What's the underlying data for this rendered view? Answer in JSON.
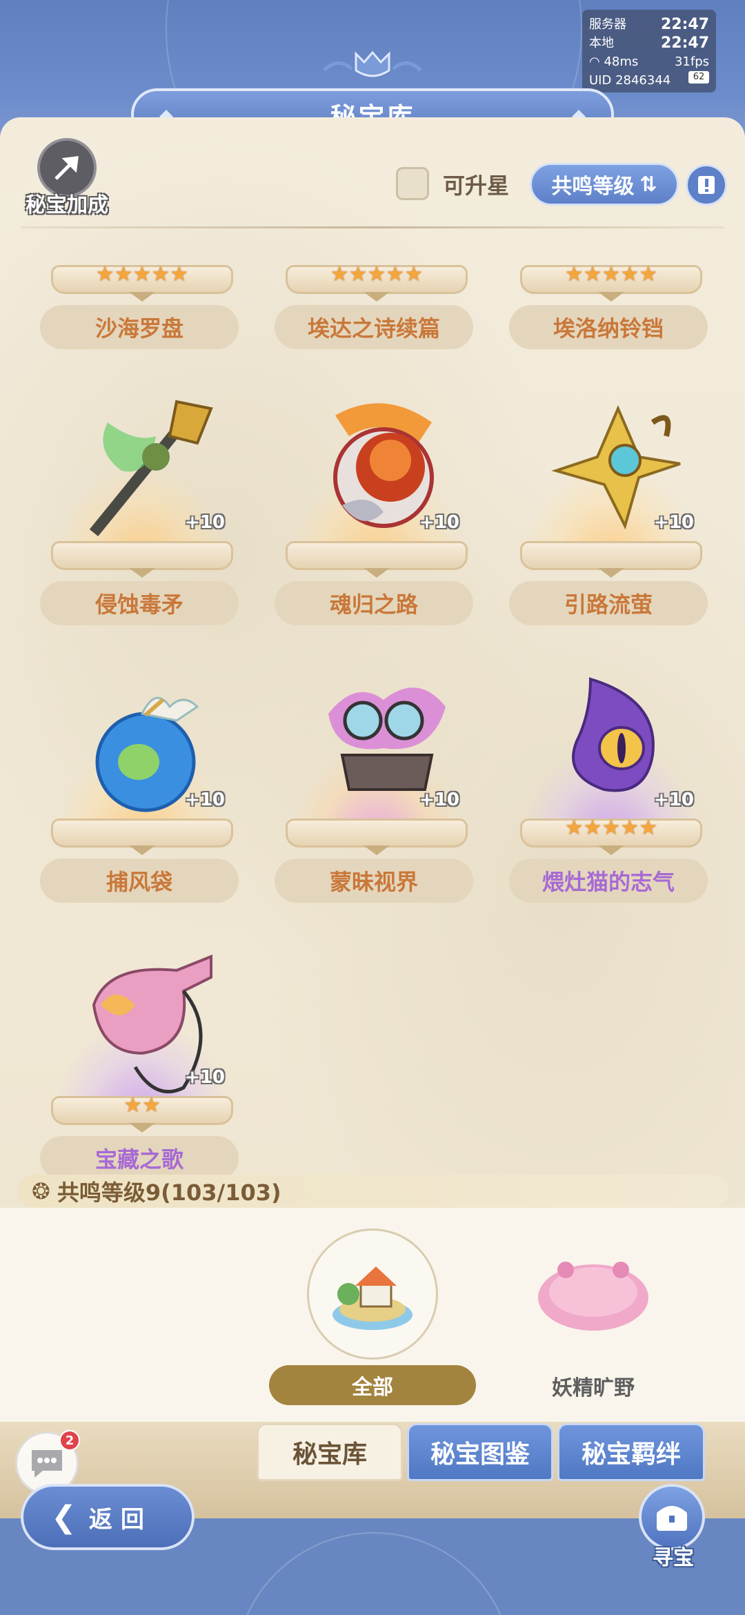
{
  "status": {
    "server_label": "服务器",
    "server_time": "22:47",
    "local_label": "本地",
    "local_time": "22:47",
    "ping": "48ms",
    "fps": "31fps",
    "uid": "UID 2846344",
    "battery": "62"
  },
  "header": {
    "title": "秘宝库",
    "bonus_label": "秘宝加成"
  },
  "filters": {
    "upgradeable_label": "可升星",
    "upgradeable_checked": false,
    "sort_label": "共鸣等级"
  },
  "treasures": [
    {
      "name": "沙海罗盘",
      "stars": "★★★★★",
      "plus": "",
      "rarity": "gold"
    },
    {
      "name": "埃达之诗续篇",
      "stars": "★★★★★",
      "plus": "",
      "rarity": "gold"
    },
    {
      "name": "埃洛纳铃铛",
      "stars": "★★★★★",
      "plus": "",
      "rarity": "gold"
    },
    {
      "name": "侵蚀毒矛",
      "stars": "",
      "plus": "+10",
      "rarity": "gold"
    },
    {
      "name": "魂归之路",
      "stars": "",
      "plus": "+10",
      "rarity": "gold"
    },
    {
      "name": "引路流萤",
      "stars": "",
      "plus": "+10",
      "rarity": "gold"
    },
    {
      "name": "捕风袋",
      "stars": "",
      "plus": "+10",
      "rarity": "gold"
    },
    {
      "name": "蒙昧视界",
      "stars": "",
      "plus": "+10",
      "rarity": "gold"
    },
    {
      "name": "煨灶猫的志气",
      "stars": "★★★★★",
      "plus": "+10",
      "rarity": "purple"
    },
    {
      "name": "宝藏之歌",
      "stars": "★★",
      "plus": "+10",
      "rarity": "purple"
    }
  ],
  "resonance": {
    "text": "共鸣等级9(103/103)"
  },
  "regions": {
    "all_label": "全部",
    "fairy_label": "妖精旷野"
  },
  "tabs": {
    "library": "秘宝库",
    "atlas": "秘宝图鉴",
    "bond": "秘宝羁绊"
  },
  "nav": {
    "back_label": "返回",
    "chat_badge": "2",
    "treasure_label": "寻宝"
  },
  "colors": {
    "accent_blue": "#5d80c8",
    "name_orange": "#c9783a",
    "name_purple": "#a76ad4",
    "star": "#f3a63b"
  }
}
